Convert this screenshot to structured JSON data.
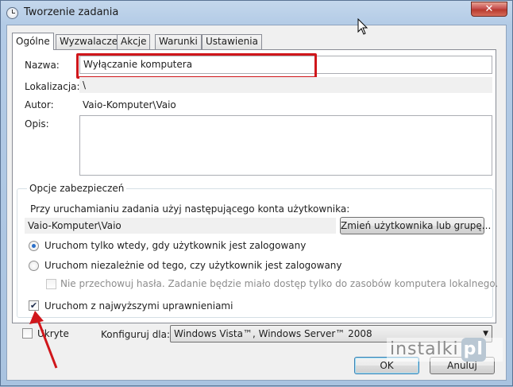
{
  "window": {
    "title": "Tworzenie zadania",
    "close_label": "✕"
  },
  "tabs": [
    {
      "label": "Ogólne",
      "active": true
    },
    {
      "label": "Wyzwalacze",
      "active": false
    },
    {
      "label": "Akcje",
      "active": false
    },
    {
      "label": "Warunki",
      "active": false
    },
    {
      "label": "Ustawienia",
      "active": false
    }
  ],
  "general": {
    "name_label": "Nazwa:",
    "name_value": "Wyłączanie komputera",
    "location_label": "Lokalizacja:",
    "location_value": "\\",
    "author_label": "Autor:",
    "author_value": "Vaio-Komputer\\Vaio",
    "description_label": "Opis:",
    "description_value": ""
  },
  "security": {
    "group_title": "Opcje zabezpieczeń",
    "account_prompt": "Przy uruchamianiu zadania użyj następującego konta użytkownika:",
    "account_value": "Vaio-Komputer\\Vaio",
    "change_user_button": "Zmień użytkownika lub grupę...",
    "radio_logged_on": "Uruchom tylko wtedy, gdy użytkownik jest zalogowany",
    "radio_logged_on_selected": true,
    "radio_any": "Uruchom niezależnie od tego, czy użytkownik jest zalogowany",
    "no_store_password": "Nie przechowuj hasła. Zadanie będzie miało dostęp tylko do zasobów komputera lokalnego.",
    "highest_privileges": "Uruchom z najwyższymi uprawnieniami",
    "highest_privileges_checked": true
  },
  "footer": {
    "hidden_label": "Ukryte",
    "hidden_checked": false,
    "configure_label": "Konfiguruj dla:",
    "configure_value": "Windows Vista™, Windows Server™ 2008",
    "ok_button": "OK",
    "cancel_button": "Anuluj"
  },
  "watermark": {
    "text": "instalki",
    "suffix": "pl"
  },
  "colors": {
    "highlight_red": "#d0161b",
    "accent_blue": "#2a6fc9"
  }
}
